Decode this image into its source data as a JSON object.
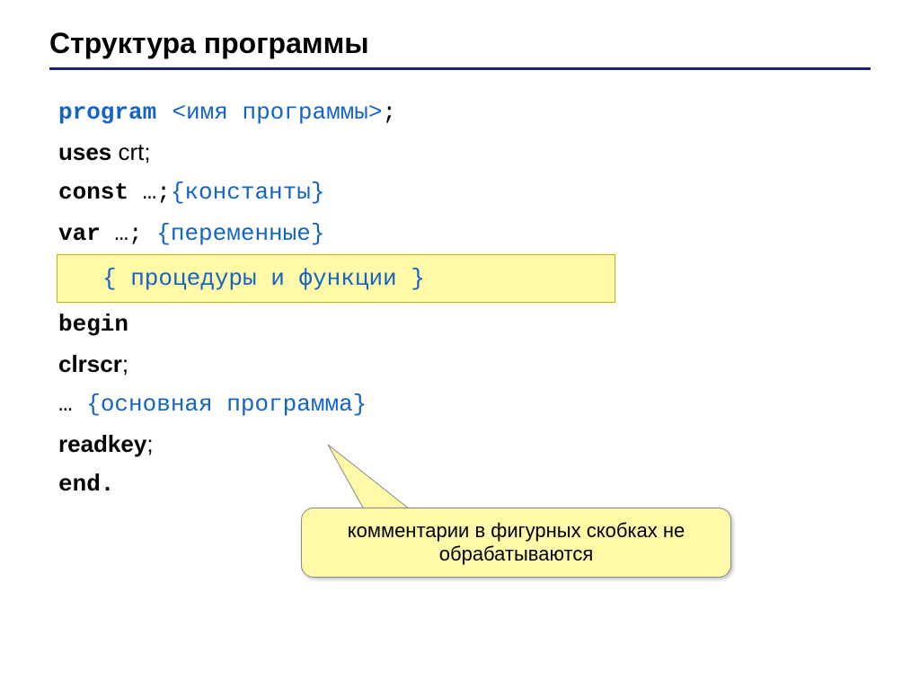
{
  "title": "Структура программы",
  "code": {
    "l1a": "program",
    "l1b": "<имя программы>",
    "l1c": ";",
    "l2a": "uses",
    "l2b": " crt;",
    "l3a": "const",
    "l3b": " …;",
    "l3c": "{константы}",
    "l4a": "var",
    "l4b": " …; ",
    "l4c": "{переменные}",
    "l5": "{ процедуры и функции }",
    "l6": "begin",
    "l7a": "clrscr",
    "l7b": ";",
    "l8a": " … ",
    "l8b": "{основная программа}",
    "l9a": "readkey",
    "l9b": ";",
    "l10": "end."
  },
  "callout": "комментарии в фигурных скобках не обрабатываются"
}
